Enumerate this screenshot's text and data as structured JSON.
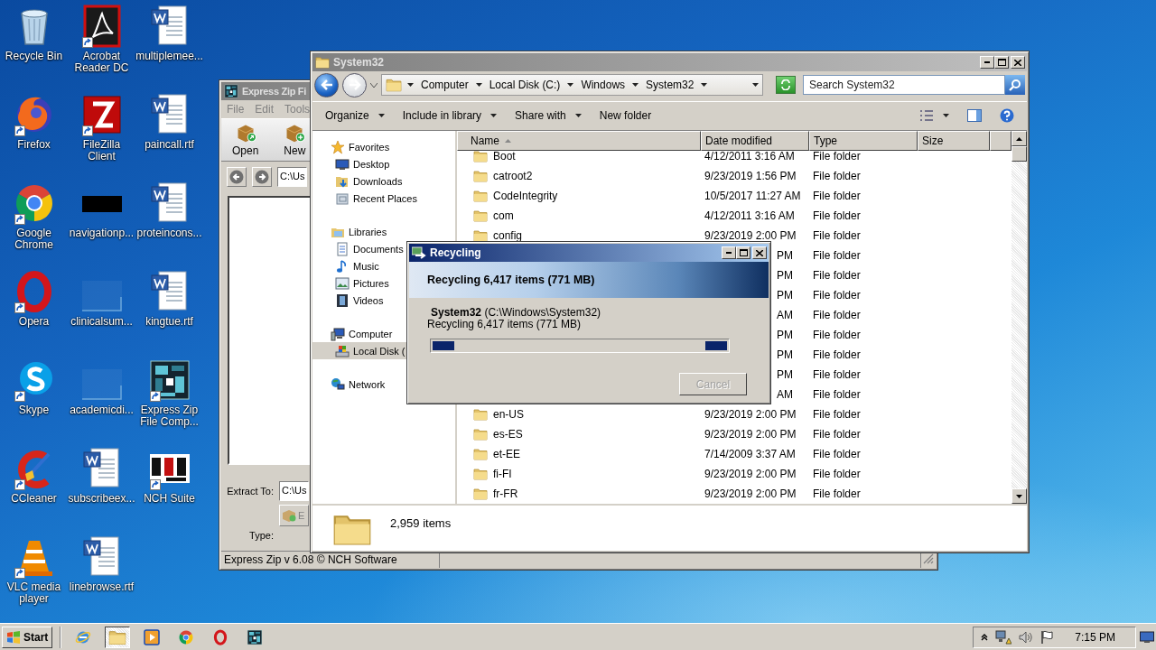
{
  "desktop": {
    "icons": [
      {
        "label": "Recycle Bin",
        "kind": "recycle",
        "shortcut": false
      },
      {
        "label": "Firefox",
        "kind": "firefox",
        "shortcut": true
      },
      {
        "label": "Google Chrome",
        "kind": "chrome",
        "shortcut": true
      },
      {
        "label": "Opera",
        "kind": "opera",
        "shortcut": true
      },
      {
        "label": "Skype",
        "kind": "skype",
        "shortcut": true
      },
      {
        "label": "CCleaner",
        "kind": "ccleaner",
        "shortcut": true
      },
      {
        "label": "VLC media player",
        "kind": "vlc",
        "shortcut": true
      },
      {
        "label": "Acrobat Reader DC",
        "kind": "acrobat",
        "shortcut": true
      },
      {
        "label": "FileZilla Client",
        "kind": "filezilla",
        "shortcut": true
      },
      {
        "label": "navigationp...",
        "kind": "dark-thumb",
        "shortcut": false
      },
      {
        "label": "clinicalsum...",
        "kind": "blank-thumb",
        "shortcut": false
      },
      {
        "label": "academicdi...",
        "kind": "blank-thumb",
        "shortcut": false
      },
      {
        "label": "subscribeex...",
        "kind": "word",
        "shortcut": false
      },
      {
        "label": "linebrowse.rtf",
        "kind": "word",
        "shortcut": false
      },
      {
        "label": "multiplemee...",
        "kind": "word",
        "shortcut": false
      },
      {
        "label": "paincall.rtf",
        "kind": "word",
        "shortcut": false
      },
      {
        "label": "proteincons...",
        "kind": "word",
        "shortcut": false
      },
      {
        "label": "kingtue.rtf",
        "kind": "word",
        "shortcut": false
      },
      {
        "label": "Express Zip File Comp...",
        "kind": "expresszip",
        "shortcut": true
      },
      {
        "label": "NCH Suite",
        "kind": "nch",
        "shortcut": true
      }
    ]
  },
  "express_zip": {
    "title": "Express Zip Fi",
    "active": false,
    "menu": [
      "File",
      "Edit",
      "Tools"
    ],
    "toolbar": [
      {
        "label": "Open",
        "kind": "open"
      },
      {
        "label": "New",
        "kind": "new"
      }
    ],
    "path": "C:\\Us",
    "extract_label": "Extract To:",
    "extract_path": "C:\\Us",
    "extract_button": "E",
    "type_label": "Type:",
    "status": "Express Zip v 6.08 © NCH Software"
  },
  "explorer": {
    "title": "System32",
    "active": false,
    "breadcrumb": [
      "Computer",
      "Local Disk (C:)",
      "Windows",
      "System32"
    ],
    "search": {
      "placeholder": "Search System32"
    },
    "commands": [
      {
        "label": "Organize",
        "dropdown": true
      },
      {
        "label": "Include in library",
        "dropdown": true
      },
      {
        "label": "Share with",
        "dropdown": true
      },
      {
        "label": "New folder",
        "dropdown": false
      }
    ],
    "nav": [
      {
        "label": "Favorites",
        "kind": "favorites",
        "selected": false,
        "children": [
          {
            "label": "Desktop",
            "kind": "desktop",
            "selected": false
          },
          {
            "label": "Downloads",
            "kind": "downloads",
            "selected": false
          },
          {
            "label": "Recent Places",
            "kind": "recent",
            "selected": false
          }
        ]
      },
      {
        "label": "Libraries",
        "kind": "libraries",
        "selected": false,
        "children": [
          {
            "label": "Documents",
            "kind": "documents",
            "selected": false
          },
          {
            "label": "Music",
            "kind": "music",
            "selected": false
          },
          {
            "label": "Pictures",
            "kind": "pictures",
            "selected": false
          },
          {
            "label": "Videos",
            "kind": "videos",
            "selected": false
          }
        ]
      },
      {
        "label": "Computer",
        "kind": "computer",
        "selected": false,
        "children": [
          {
            "label": "Local Disk (",
            "kind": "disk",
            "selected": true
          }
        ]
      },
      {
        "label": "Network",
        "kind": "network",
        "selected": false
      }
    ],
    "columns": [
      "Name",
      "Date modified",
      "Type",
      "Size"
    ],
    "rows": [
      {
        "kind": "full",
        "name": "Boot",
        "date": "4/12/2011 3:16 AM",
        "type": "File folder"
      },
      {
        "kind": "full",
        "name": "catroot2",
        "date": "9/23/2019 1:56 PM",
        "type": "File folder"
      },
      {
        "kind": "full",
        "name": "CodeIntegrity",
        "date": "10/5/2017 11:27 AM",
        "type": "File folder"
      },
      {
        "kind": "full",
        "name": "com",
        "date": "4/12/2011 3:16 AM",
        "type": "File folder"
      },
      {
        "kind": "full",
        "name": "config",
        "date": "9/23/2019 2:00 PM",
        "type": "File folder"
      },
      {
        "kind": "covered",
        "date": "PM",
        "type": "File folder"
      },
      {
        "kind": "covered",
        "date": "PM",
        "type": "File folder"
      },
      {
        "kind": "covered",
        "date": "PM",
        "type": "File folder"
      },
      {
        "kind": "covered",
        "date": "AM",
        "type": "File folder"
      },
      {
        "kind": "covered",
        "date": "PM",
        "type": "File folder"
      },
      {
        "kind": "covered",
        "date": "PM",
        "type": "File folder"
      },
      {
        "kind": "covered",
        "date": "PM",
        "type": "File folder"
      },
      {
        "kind": "covered",
        "date": "AM",
        "type": "File folder"
      },
      {
        "kind": "full",
        "name": "en-US",
        "date": "9/23/2019 2:00 PM",
        "type": "File folder"
      },
      {
        "kind": "full",
        "name": "es-ES",
        "date": "9/23/2019 2:00 PM",
        "type": "File folder"
      },
      {
        "kind": "full",
        "name": "et-EE",
        "date": "7/14/2009 3:37 AM",
        "type": "File folder"
      },
      {
        "kind": "full",
        "name": "fi-FI",
        "date": "9/23/2019 2:00 PM",
        "type": "File folder"
      },
      {
        "kind": "full",
        "name": "fr-FR",
        "date": "9/23/2019 2:00 PM",
        "type": "File folder"
      }
    ],
    "status": "2,959 items"
  },
  "dialog": {
    "title": "Recycling",
    "active": true,
    "progress_indeterminate": true,
    "heading": "Recycling 6,417 items (771 MB)",
    "source": "**System32** (C:\\Windows\\System32)",
    "detail": "Recycling 6,417 items (771 MB)",
    "button": {
      "label": "Cancel",
      "disabled": true
    }
  },
  "taskbar": {
    "start": "Start",
    "apps": [
      {
        "kind": "ie",
        "selected": false
      },
      {
        "kind": "explorer",
        "selected": true
      },
      {
        "kind": "media",
        "selected": false
      },
      {
        "kind": "chrome",
        "selected": false
      },
      {
        "kind": "opera",
        "selected": false
      },
      {
        "kind": "expresszip",
        "selected": false
      }
    ],
    "clock": "7:15 PM"
  }
}
